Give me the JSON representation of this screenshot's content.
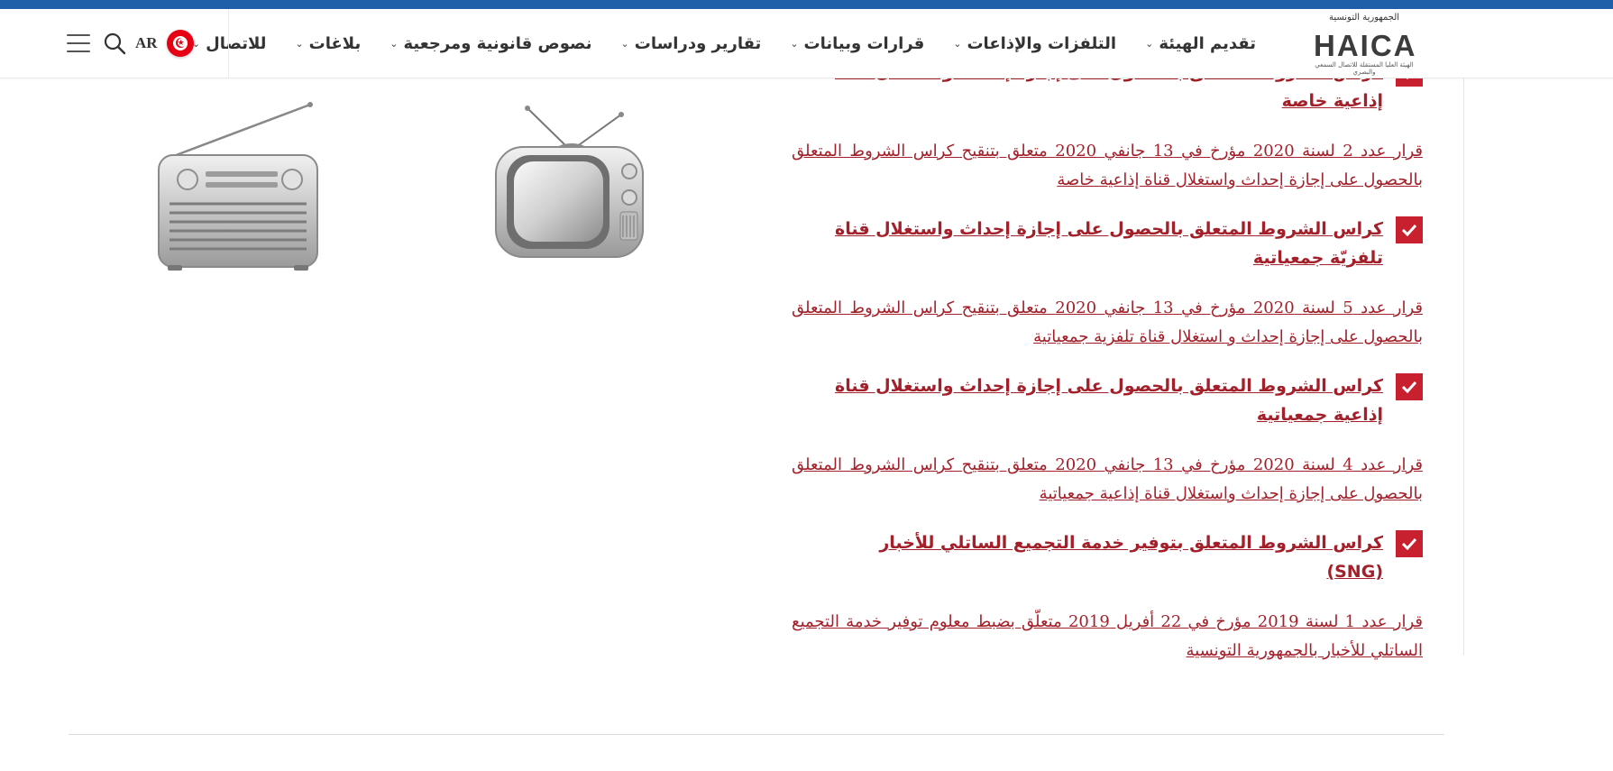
{
  "header": {
    "logo": {
      "top_text": "الجمهورية التونسية",
      "word": "HAICA",
      "bottom_text": "الهيئة العليا المستقلة للاتصال السمعي والبصري"
    },
    "nav": [
      {
        "label": "تقديم الهيئة",
        "has_dropdown": true
      },
      {
        "label": "التلفزات والإذاعات",
        "has_dropdown": true
      },
      {
        "label": "قرارات وبيانات",
        "has_dropdown": true
      },
      {
        "label": "تقارير ودراسات",
        "has_dropdown": true
      },
      {
        "label": "نصوص قانونية ومرجعية",
        "has_dropdown": true
      },
      {
        "label": "بلاغات",
        "has_dropdown": true
      },
      {
        "label": "للاتصال",
        "has_dropdown": true
      }
    ],
    "lang_label": "AR",
    "icons": {
      "search": "search-icon",
      "menu": "hamburger-menu-icon",
      "flag": "tunisia-flag-icon"
    }
  },
  "items": [
    {
      "title": "كراس الشروط المتعلق بالحصول على إجازة إحداث واستغلال قناة إذاعية خاصة",
      "decision": "قرار عدد 2 لسنة 2020 مؤرخ في 13 جانفي 2020 متعلق بتنقيح كراس الشروط المتعلق بالحصول على إجازة إحداث واستغلال قناة إذاعية خاصة"
    },
    {
      "title": "كراس الشروط المتعلق بالحصول على إجازة إحداث واستغلال قناة تلفزيّة جمعياتية",
      "decision": "قرار عدد 5 لسنة 2020 مؤرخ في 13 جانفي 2020 متعلق بتنقيح كراس الشروط المتعلق بالحصول على إجازة إحداث و استغلال قناة تلفزية جمعياتية"
    },
    {
      "title": "كراس الشروط المتعلق بالحصول على إجازة إحداث واستغلال قناة إذاعية جمعياتية",
      "decision": "قرار عدد 4 لسنة 2020 مؤرخ في 13 جانفي 2020 متعلق بتنقيح كراس الشروط المتعلق بالحصول على إجازة إحداث واستغلال قناة إذاعية جمعياتية"
    },
    {
      "title": "كراس الشروط المتعلق بتوفير خدمة التجميع الساتلي للأخبار (SNG)",
      "decision": "قرار عدد 1 لسنة 2019 مؤرخ في 22 أفريل 2019 متعلّق بضبط معلوم توفير خدمة التجميع الساتلي للأخبار بالجمهورية التونسية"
    }
  ],
  "colors": {
    "top_stripe": "#1f5ea8",
    "accent_red": "#c8202f",
    "link_red": "#a3202a"
  }
}
